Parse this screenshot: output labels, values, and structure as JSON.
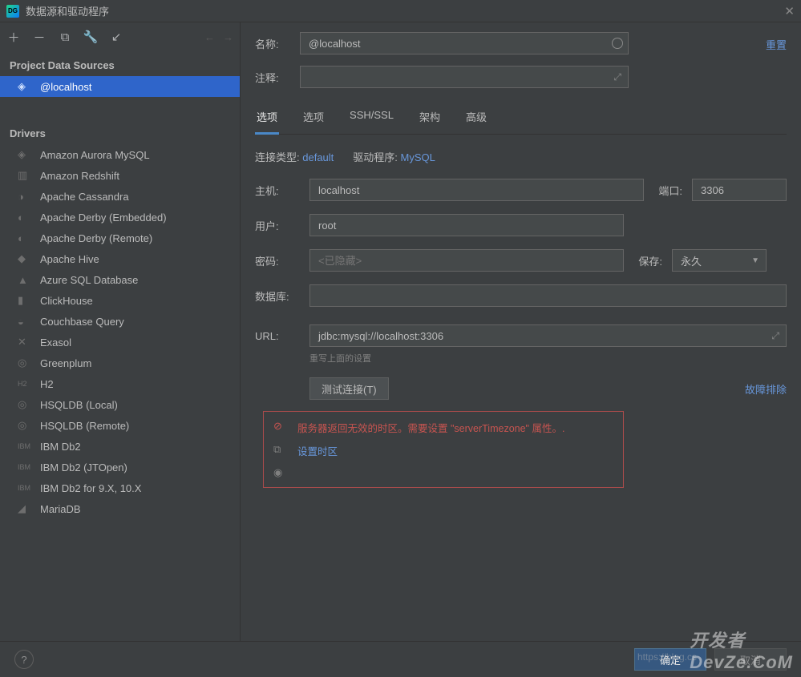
{
  "window": {
    "title": "数据源和驱动程序"
  },
  "sidebar": {
    "sections": {
      "ds_header": "Project Data Sources",
      "drivers_header": "Drivers"
    },
    "datasources": [
      {
        "label": "@localhost"
      }
    ],
    "drivers": [
      {
        "label": "Amazon Aurora MySQL"
      },
      {
        "label": "Amazon Redshift"
      },
      {
        "label": "Apache Cassandra"
      },
      {
        "label": "Apache Derby (Embedded)"
      },
      {
        "label": "Apache Derby (Remote)"
      },
      {
        "label": "Apache Hive"
      },
      {
        "label": "Azure SQL Database"
      },
      {
        "label": "ClickHouse"
      },
      {
        "label": "Couchbase Query"
      },
      {
        "label": "Exasol"
      },
      {
        "label": "Greenplum"
      },
      {
        "label": "H2"
      },
      {
        "label": "HSQLDB (Local)"
      },
      {
        "label": "HSQLDB (Remote)"
      },
      {
        "label": "IBM Db2"
      },
      {
        "label": "IBM Db2 (JTOpen)"
      },
      {
        "label": "IBM Db2 for 9.X, 10.X"
      },
      {
        "label": "MariaDB"
      }
    ]
  },
  "form": {
    "name_label": "名称:",
    "name_value": "@localhost",
    "comment_label": "注释:",
    "reset": "重置",
    "tabs": [
      "选项",
      "选项",
      "SSH/SSL",
      "架构",
      "高级"
    ],
    "conn_type_label": "连接类型:",
    "conn_type_value": "default",
    "driver_label": "驱动程序:",
    "driver_value": "MySQL",
    "host_label": "主机:",
    "host_value": "localhost",
    "port_label": "端口:",
    "port_value": "3306",
    "user_label": "用户:",
    "user_value": "root",
    "password_label": "密码:",
    "password_placeholder": "<已隐藏>",
    "save_label": "保存:",
    "save_value": "永久",
    "database_label": "数据库:",
    "url_label": "URL:",
    "url_value": "jdbc:mysql://localhost:3306",
    "url_hint": "重写上面的设置",
    "test_btn": "测试连接(T)",
    "troubleshoot": "故障排除",
    "error_msg": "服务器返回无效的时区。需要设置 \"serverTimezone\" 属性。.",
    "error_link": "设置时区"
  },
  "footer": {
    "ok": "确定",
    "cancel": "取消",
    "watermark": "开发者\nDevZe.CoM",
    "watermark_url": "https://blog.cs"
  }
}
